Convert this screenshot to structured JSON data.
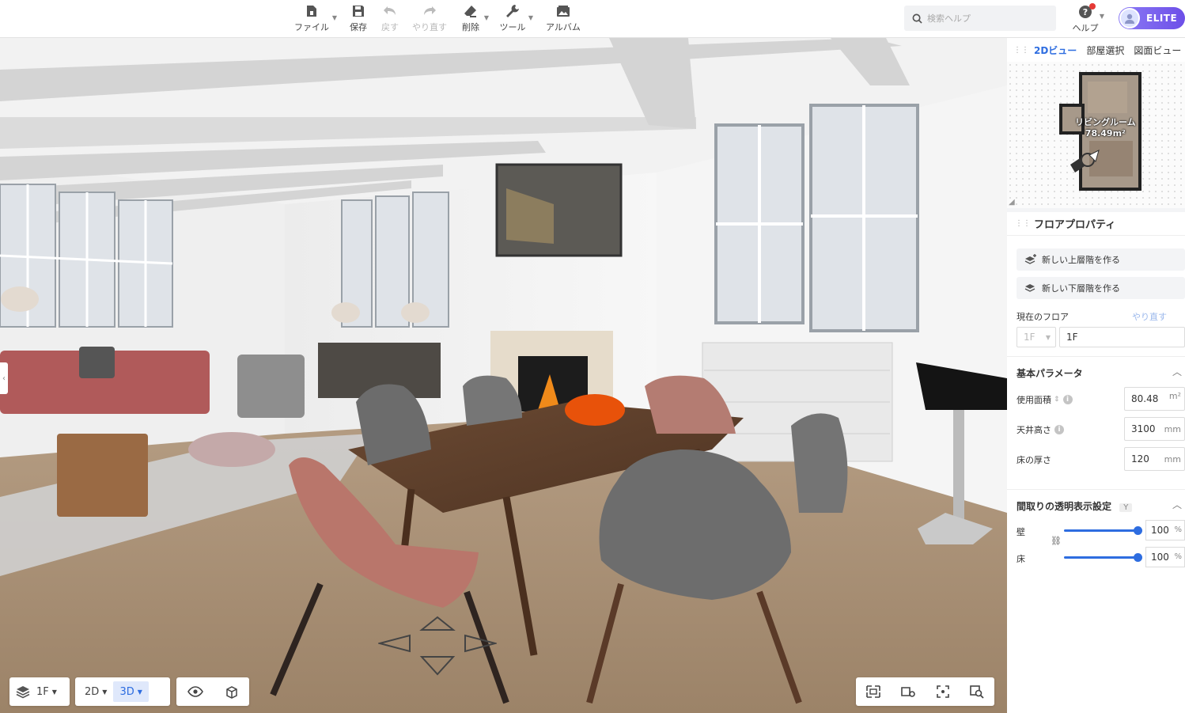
{
  "toolbar": {
    "file": "ファイル",
    "save": "保存",
    "undo": "戻す",
    "redo": "やり直す",
    "delete": "削除",
    "tools": "ツール",
    "album": "アルバム",
    "search_placeholder": "検索ヘルプ",
    "help": "ヘルプ",
    "plan": "ELITE"
  },
  "minimap": {
    "tabs": [
      "2Dビュー",
      "部屋選択",
      "図面ビュー"
    ],
    "room_name": "リビングルーム",
    "room_area": "78.49m²"
  },
  "floor_properties": {
    "title": "フロアプロパティ",
    "new_upper": "新しい上層階を作る",
    "new_lower": "新しい下層階を作る",
    "current_floor_label": "現在のフロア",
    "redo_link": "やり直す",
    "floor_select": "1F",
    "floor_name": "1F"
  },
  "basic_params": {
    "title": "基本パラメータ",
    "area_label": "使用面積",
    "area_value": "80.48",
    "area_unit": "m²",
    "ceiling_label": "天井高さ",
    "ceiling_value": "3100",
    "ceiling_unit": "mm",
    "floor_thickness_label": "床の厚さ",
    "floor_thickness_value": "120",
    "floor_thickness_unit": "mm"
  },
  "transparency": {
    "title": "間取りの透明表示設定",
    "badge": "Y",
    "wall_label": "壁",
    "wall_value": "100",
    "floor_label": "床",
    "floor_value": "100",
    "unit": "%",
    "wall_level_pct": 100,
    "floor_level_pct": 100
  },
  "bottom": {
    "floor": "1F",
    "view_2d": "2D",
    "view_3d": "3D",
    "active_view": "3D"
  },
  "colors": {
    "accent": "#2e6de0",
    "elite_start": "#8b7bf5",
    "elite_end": "#6d4fe8",
    "notification": "#e53935"
  },
  "icons": {
    "file": "file-icon",
    "save": "save-icon",
    "undo": "undo-icon",
    "redo": "redo-icon",
    "delete": "eraser-icon",
    "tools": "wrench-icon",
    "album": "album-icon",
    "search": "search-icon",
    "help": "help-icon"
  }
}
